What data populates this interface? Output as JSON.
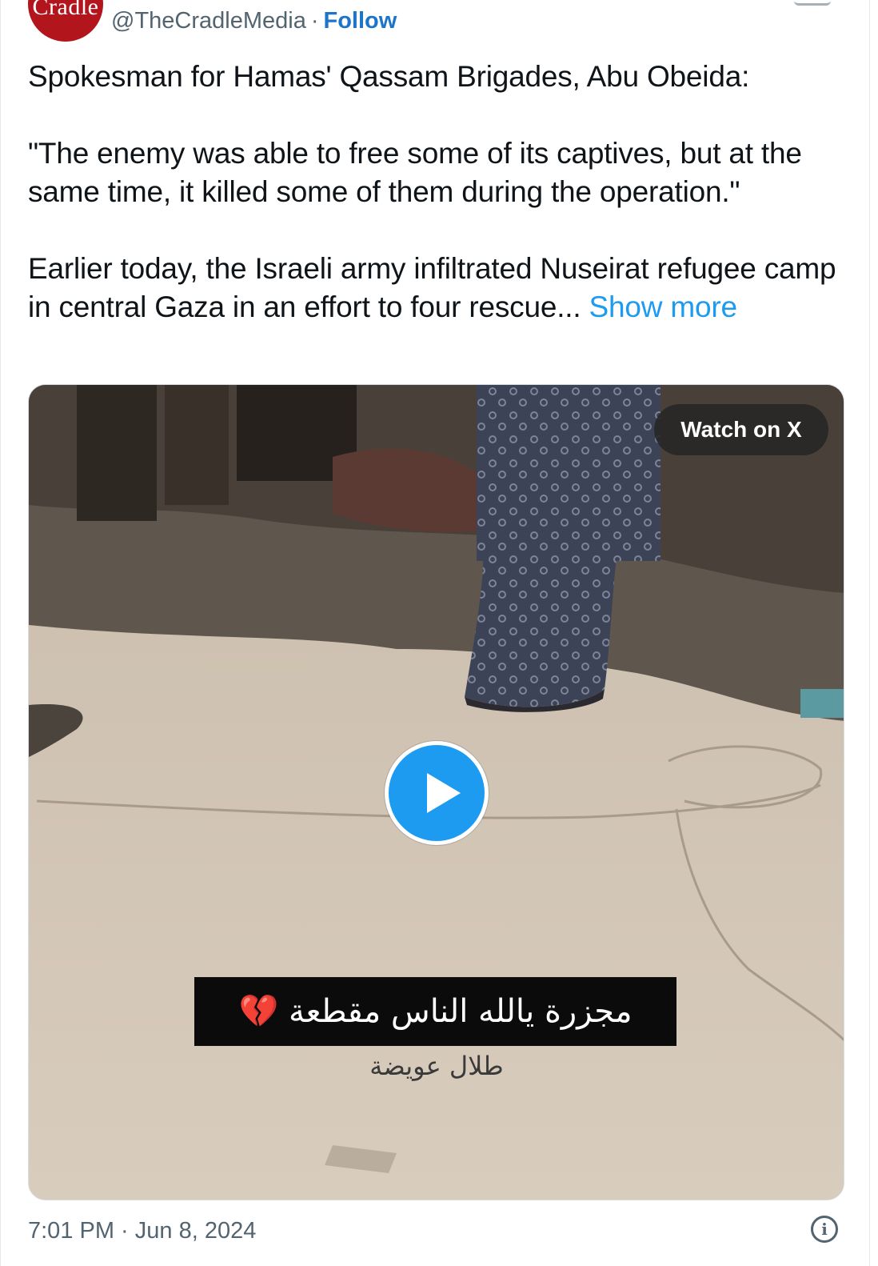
{
  "header": {
    "avatar_text": "Cradle",
    "handle": "@TheCradleMedia",
    "separator": "·",
    "follow_label": "Follow"
  },
  "post": {
    "line1": "Spokesman for Hamas' Qassam Brigades, Abu Obeida:",
    "quote": "\"The enemy was able to free some of its captives, but at the same time, it killed some of them during the operation.\"",
    "body": "Earlier today, the Israeli army infiltrated Nuseirat refugee camp in central Gaza in an effort to four rescue... ",
    "show_more": "Show more"
  },
  "media": {
    "watch_label": "Watch on X",
    "caption_text": "مجزرة يالله الناس مقطعة",
    "caption_emoji": "💔",
    "sub_caption": "طلال عويضة"
  },
  "footer": {
    "timestamp": "7:01 PM · Jun 8, 2024",
    "info_icon": "i"
  },
  "colors": {
    "follow": "#1d74c9",
    "link": "#1d9bf0",
    "play_button": "#1d9bf0",
    "avatar_bg": "#b3151c"
  }
}
